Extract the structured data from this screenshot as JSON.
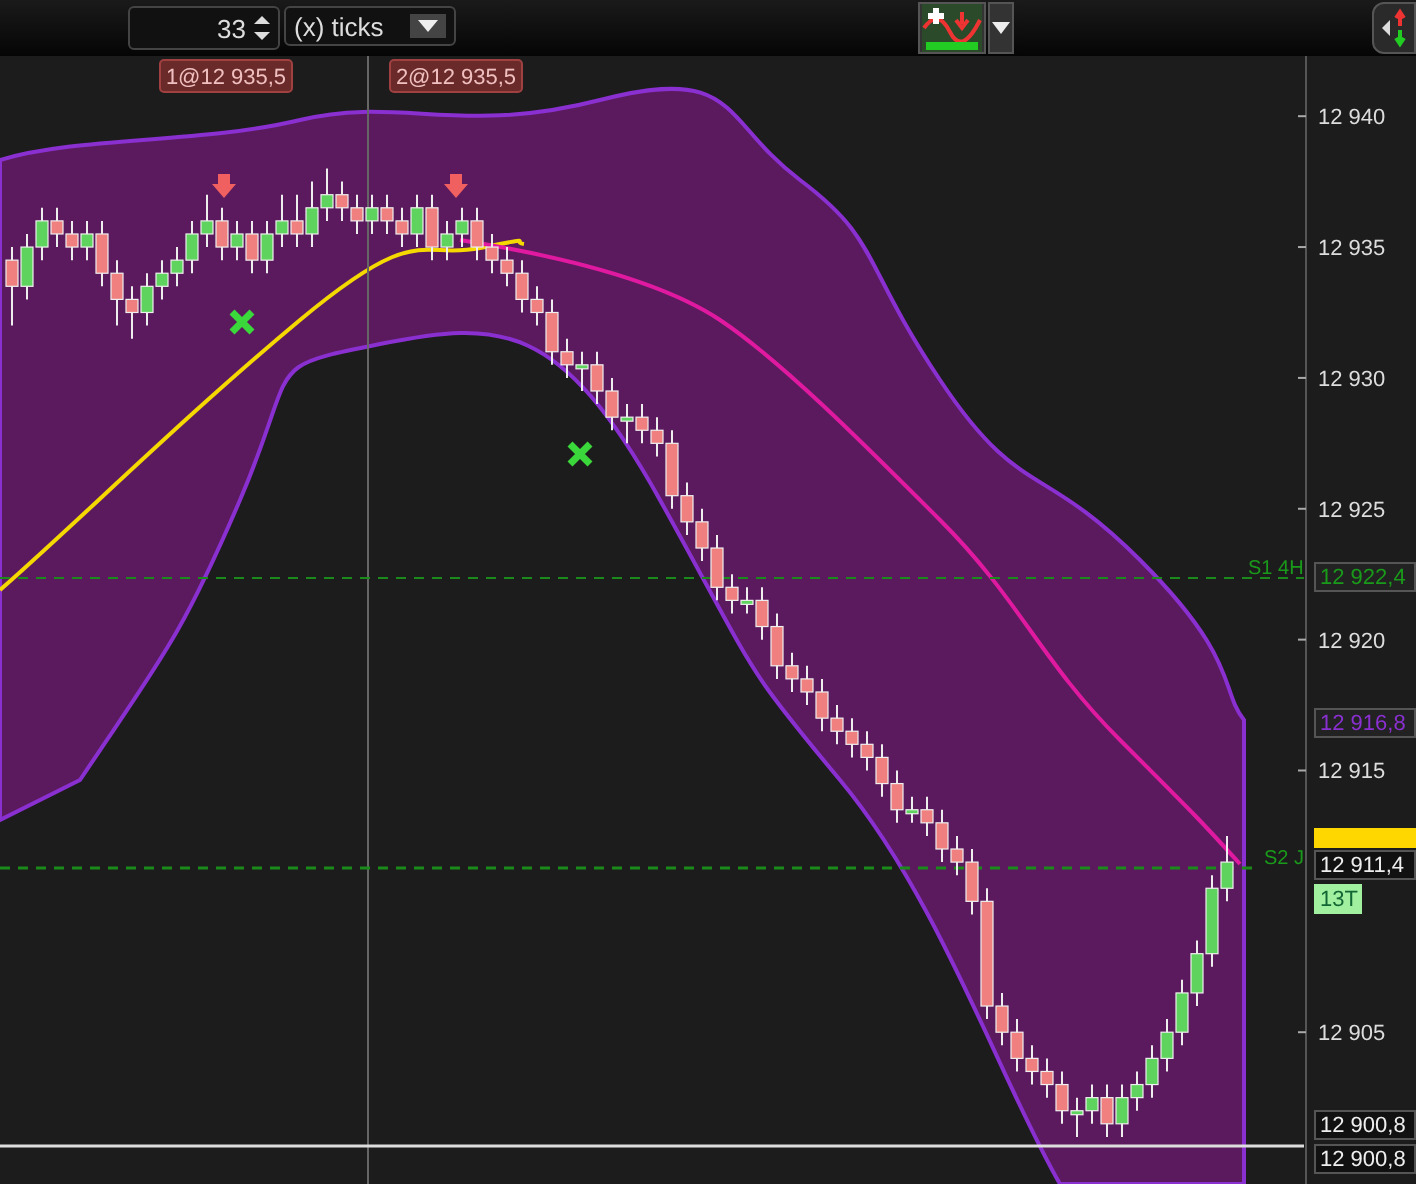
{
  "toolbar": {
    "period_value": "33",
    "period_unit": "(x) ticks"
  },
  "chart": {
    "trade_labels": [
      "1@12 935,5",
      "2@12 935,5"
    ],
    "level_labels": [
      "S1 4H",
      "S2 J"
    ],
    "price_tags": [
      {
        "text": "12 922,4",
        "kind": "level"
      },
      {
        "text": "12 916,8",
        "kind": "band"
      },
      {
        "kind": "last"
      },
      {
        "text": "12 911,4",
        "kind": "cursor"
      },
      {
        "text": "13T",
        "kind": "timer"
      },
      {
        "text": "12 900,8",
        "kind": "cursor"
      },
      {
        "text": "12 900,8",
        "kind": "cursor"
      }
    ],
    "chart_data": {
      "type": "candlestick",
      "ylim": [
        12899.2,
        12942.3
      ],
      "yticks": [
        {
          "value": 12940,
          "label": "12 940"
        },
        {
          "value": 12935,
          "label": "12 935"
        },
        {
          "value": 12930,
          "label": "12 930"
        },
        {
          "value": 12925,
          "label": "12 925"
        },
        {
          "value": 12920,
          "label": "12 920"
        },
        {
          "value": 12915,
          "label": "12 915"
        },
        {
          "value": 12905,
          "label": "12 905"
        }
      ],
      "ohlc": [
        [
          12934.5,
          12935,
          12932,
          12933.5
        ],
        [
          12933.5,
          12935.5,
          12933,
          12935
        ],
        [
          12935,
          12936.5,
          12934.5,
          12936
        ],
        [
          12936,
          12936.5,
          12935,
          12935.5
        ],
        [
          12935.5,
          12936,
          12934.5,
          12935
        ],
        [
          12935,
          12936,
          12934.5,
          12935.5
        ],
        [
          12935.5,
          12936,
          12933.5,
          12934
        ],
        [
          12934,
          12934.5,
          12932,
          12933
        ],
        [
          12933,
          12933.5,
          12931.5,
          12932.5
        ],
        [
          12932.5,
          12934,
          12932,
          12933.5
        ],
        [
          12933.5,
          12934.5,
          12933,
          12934
        ],
        [
          12934,
          12935,
          12933.5,
          12934.5
        ],
        [
          12934.5,
          12936,
          12934,
          12935.5
        ],
        [
          12935.5,
          12937,
          12935,
          12936
        ],
        [
          12936,
          12936.5,
          12934.5,
          12935
        ],
        [
          12935,
          12936,
          12934.5,
          12935.5
        ],
        [
          12935.5,
          12936,
          12934,
          12934.5
        ],
        [
          12934.5,
          12936,
          12934,
          12935.5
        ],
        [
          12935.5,
          12937,
          12935,
          12936
        ],
        [
          12936,
          12937,
          12935,
          12935.5
        ],
        [
          12935.5,
          12937.5,
          12935,
          12936.5
        ],
        [
          12936.5,
          12938,
          12936,
          12937
        ],
        [
          12937,
          12937.5,
          12936,
          12936.5
        ],
        [
          12936.5,
          12937,
          12935.5,
          12936
        ],
        [
          12936,
          12937,
          12935.5,
          12936.5
        ],
        [
          12936.5,
          12937,
          12935.5,
          12936
        ],
        [
          12936,
          12936.5,
          12935,
          12935.5
        ],
        [
          12935.5,
          12937,
          12935,
          12936.5
        ],
        [
          12936.5,
          12937,
          12934.5,
          12935
        ],
        [
          12935,
          12936,
          12934.5,
          12935.5
        ],
        [
          12935.5,
          12936.5,
          12935,
          12936
        ],
        [
          12936,
          12936.5,
          12934.5,
          12935
        ],
        [
          12935,
          12935.5,
          12934,
          12934.5
        ],
        [
          12934.5,
          12935,
          12933.5,
          12934
        ],
        [
          12934,
          12934.5,
          12932.5,
          12933
        ],
        [
          12933,
          12933.5,
          12932,
          12932.5
        ],
        [
          12932.5,
          12933,
          12930.5,
          12931
        ],
        [
          12931,
          12931.5,
          12930,
          12930.5
        ],
        [
          12930.5,
          12931,
          12929.5,
          12930.5
        ],
        [
          12930.5,
          12931,
          12929,
          12929.5
        ],
        [
          12929.5,
          12930,
          12928,
          12928.5
        ],
        [
          12928.5,
          12929,
          12927.5,
          12928.5
        ],
        [
          12928.5,
          12929,
          12927.5,
          12928
        ],
        [
          12928,
          12928.5,
          12927,
          12927.5
        ],
        [
          12927.5,
          12928,
          12925,
          12925.5
        ],
        [
          12925.5,
          12926,
          12924,
          12924.5
        ],
        [
          12924.5,
          12925,
          12923,
          12923.5
        ],
        [
          12923.5,
          12924,
          12921.5,
          12922
        ],
        [
          12922,
          12922.5,
          12921,
          12921.5
        ],
        [
          12921.5,
          12922,
          12921,
          12921.5
        ],
        [
          12921.5,
          12922,
          12920,
          12920.5
        ],
        [
          12920.5,
          12921,
          12918.5,
          12919
        ],
        [
          12919,
          12919.5,
          12918,
          12918.5
        ],
        [
          12918.5,
          12919,
          12917.5,
          12918
        ],
        [
          12918,
          12918.5,
          12916.5,
          12917
        ],
        [
          12917,
          12917.5,
          12916,
          12916.5
        ],
        [
          12916.5,
          12917,
          12915.5,
          12916
        ],
        [
          12916,
          12916.5,
          12915,
          12915.5
        ],
        [
          12915.5,
          12916,
          12914,
          12914.5
        ],
        [
          12914.5,
          12915,
          12913,
          12913.5
        ],
        [
          12913.5,
          12914,
          12913,
          12913.5
        ],
        [
          12913.5,
          12914,
          12912.5,
          12913
        ],
        [
          12913,
          12913.5,
          12911.5,
          12912
        ],
        [
          12912,
          12912.5,
          12911,
          12911.5
        ],
        [
          12911.5,
          12912,
          12909.5,
          12910
        ],
        [
          12910,
          12910.5,
          12905.5,
          12906
        ],
        [
          12906,
          12906.5,
          12904.5,
          12905
        ],
        [
          12905,
          12905.5,
          12903.5,
          12904
        ],
        [
          12904,
          12904.5,
          12903,
          12903.5
        ],
        [
          12903.5,
          12904,
          12902.5,
          12903
        ],
        [
          12903,
          12903.5,
          12901.5,
          12902
        ],
        [
          12902,
          12902.5,
          12901,
          12902
        ],
        [
          12902,
          12903,
          12901.5,
          12902.5
        ],
        [
          12902.5,
          12903,
          12901,
          12901.5
        ],
        [
          12901.5,
          12903,
          12901,
          12902.5
        ],
        [
          12902.5,
          12903.5,
          12902,
          12903
        ],
        [
          12903,
          12904.5,
          12902.5,
          12904
        ],
        [
          12904,
          12905.5,
          12903.5,
          12905
        ],
        [
          12905,
          12907,
          12904.5,
          12906.5
        ],
        [
          12906.5,
          12908.5,
          12906,
          12908
        ],
        [
          12908,
          12911,
          12907.5,
          12910.5
        ],
        [
          12910.5,
          12912.5,
          12910,
          12911.5
        ]
      ]
    }
  }
}
